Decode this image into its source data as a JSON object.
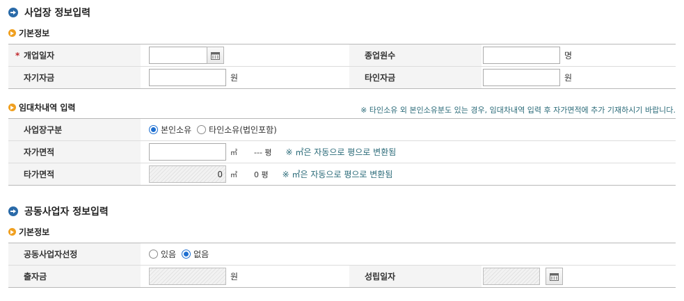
{
  "section1": {
    "title": "사업장 정보입력",
    "basic": {
      "title": "기본정보",
      "required_mark": "*",
      "open_date_label": "개업일자",
      "open_date_value": "",
      "employees_label": "종업원수",
      "employees_value": "",
      "employees_unit": "명",
      "own_capital_label": "자기자금",
      "own_capital_value": "",
      "own_capital_unit": "원",
      "other_capital_label": "타인자금",
      "other_capital_value": "",
      "other_capital_unit": "원"
    },
    "lease": {
      "title": "임대차내역 입력",
      "notice": "※ 타인소유 외 본인소유분도 있는 경우, 임대차내역 입력 후 자가면적에 추가 기재하시기 바랍니다.",
      "type_label": "사업장구분",
      "option_own": "본인소유",
      "option_other": "타인소유(법인포함)",
      "selected": "본인소유",
      "own_area_label": "자가면적",
      "own_area_value": "",
      "area_unit": "㎡",
      "own_pyeong": "--- 평",
      "auto_hint": "※ ㎡은 자동으로 평으로 변환됨",
      "other_area_label": "타가면적",
      "other_area_value": "0",
      "other_pyeong": "0 평"
    }
  },
  "section2": {
    "title": "공동사업자 정보입력",
    "basic": {
      "title": "기본정보",
      "joint_label": "공동사업자선정",
      "option_yes": "있음",
      "option_no": "없음",
      "selected": "없음",
      "investment_label": "출자금",
      "investment_value": "",
      "investment_unit": "원",
      "established_label": "성립일자",
      "established_value": ""
    }
  },
  "icons": {
    "section": "arrow-circle-icon",
    "subsection": "bullet-arrow-icon",
    "calendar": "calendar-icon"
  },
  "colors": {
    "section_icon": "#2a6aa8",
    "sub_icon": "#f0a020",
    "required": "#c0282d",
    "notice": "#2a6a78",
    "radio_selected": "#1e6fd0"
  }
}
